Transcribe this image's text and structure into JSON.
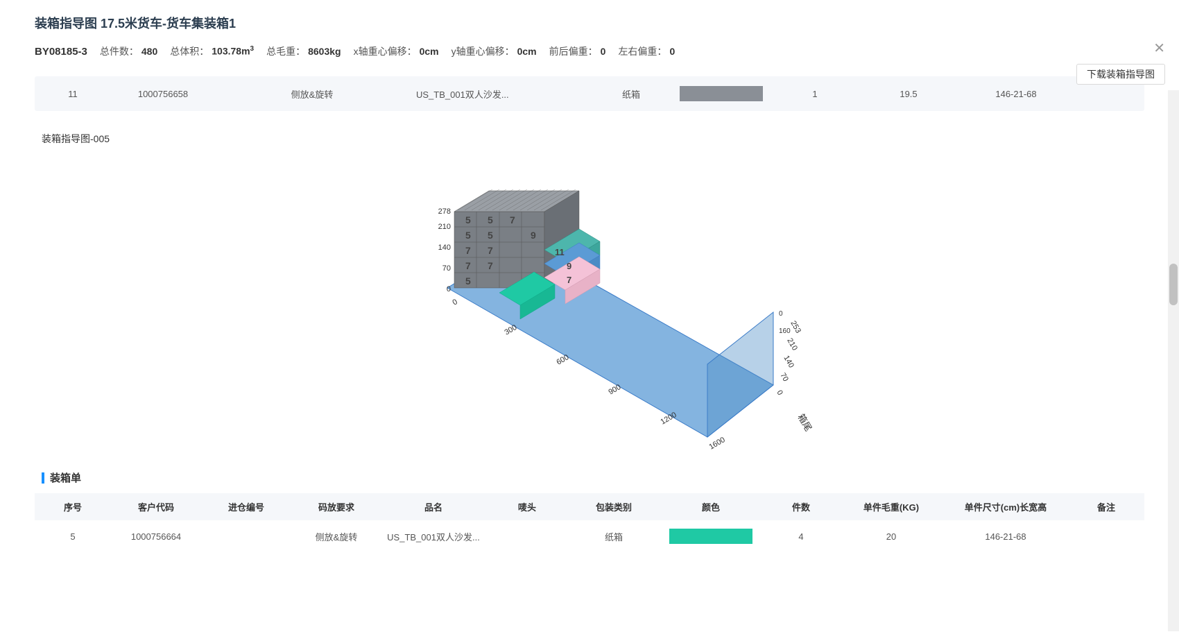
{
  "title": "装箱指导图 17.5米货车-货车集装箱1",
  "doc_id": "BY08185-3",
  "summary": {
    "total_qty_label": "总件数：",
    "total_qty": "480",
    "total_vol_label": "总体积：",
    "total_vol": "103.78m",
    "total_gw_label": "总毛重：",
    "total_gw": "8603kg",
    "x_offset_label": "x轴重心偏移：",
    "x_offset": "0cm",
    "y_offset_label": "y轴重心偏移：",
    "y_offset": "0cm",
    "fb_bias_label": "前后偏重：",
    "fb_bias": "0",
    "lr_bias_label": "左右偏重：",
    "lr_bias": "0"
  },
  "download_label": "下载装箱指导图",
  "prev_row": {
    "seq": "11",
    "code": "1000756658",
    "req": "侧放&旋转",
    "name": "US_TB_001双人沙发...",
    "pack": "纸箱",
    "qty": "1",
    "gw": "19.5",
    "size": "146-21-68"
  },
  "section_label": "装箱指导图-005",
  "viz": {
    "y_ticks": [
      "278",
      "210",
      "140",
      "70",
      "0"
    ],
    "x_ticks": [
      "0",
      "300",
      "600",
      "900",
      "1200",
      "1600"
    ],
    "z_ticks": [
      "0",
      "70",
      "140",
      "210",
      "253"
    ],
    "axis_label": "箱尾",
    "box_labels": {
      "top": "5",
      "mid1": "5",
      "mid2": "7",
      "row3a": "5",
      "row3b": "5",
      "row3c": "9",
      "row4a": "7",
      "row4b": "7",
      "row4c": "11",
      "row5a": "7",
      "row5b": "7",
      "row5c": "9",
      "row6": "5",
      "row6b": "7"
    }
  },
  "list_header": "装箱单",
  "columns": {
    "seq": "序号",
    "code": "客户代码",
    "wh": "进仓编号",
    "req": "码放要求",
    "name": "品名",
    "mark": "唛头",
    "pack": "包装类别",
    "color": "颜色",
    "qty": "件数",
    "gw": "单件毛重(KG)",
    "size": "单件尺寸(cm)长宽高",
    "note": "备注"
  },
  "row": {
    "seq": "5",
    "code": "1000756664",
    "req": "侧放&旋转",
    "name": "US_TB_001双人沙发...",
    "pack": "纸箱",
    "qty": "4",
    "gw": "20",
    "size": "146-21-68"
  }
}
